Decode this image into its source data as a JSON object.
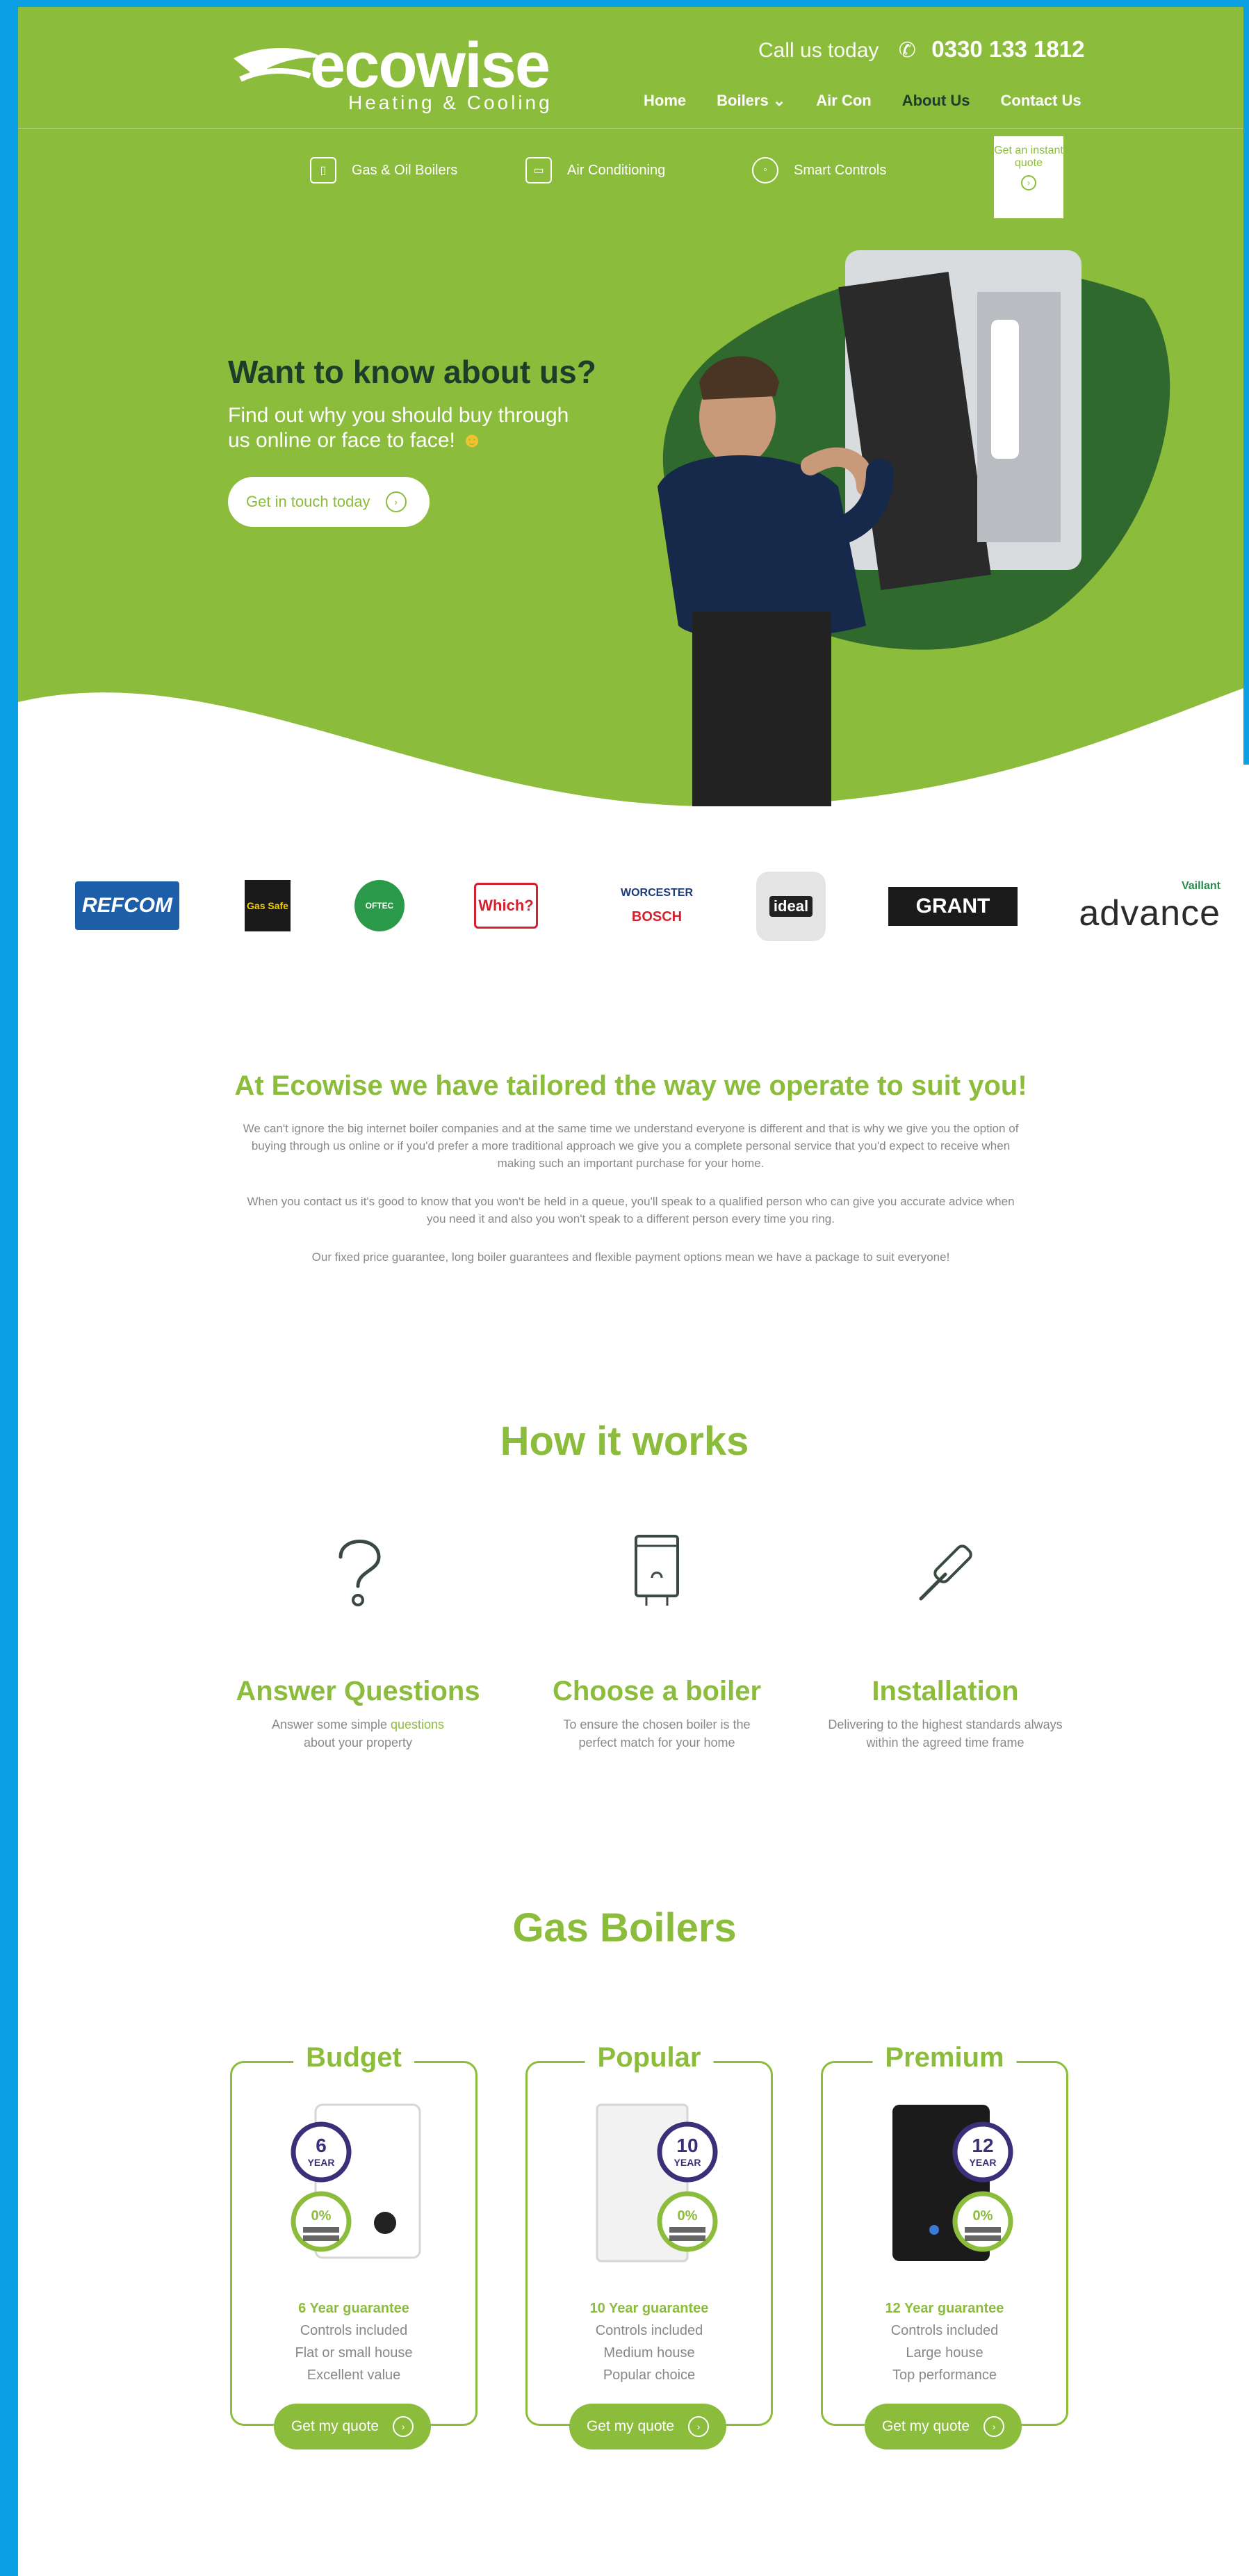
{
  "header": {
    "logo_text": "ecowise",
    "logo_tagline": "Heating & Cooling",
    "call_label": "Call us today",
    "phone_icon": "phone-icon",
    "phone": "0330 133 1812",
    "nav": [
      "Home",
      "Boilers",
      "Air Con",
      "About Us",
      "Contact Us"
    ]
  },
  "subnav": {
    "items": [
      {
        "label": "Gas & Oil Boilers",
        "icon": "boiler-icon"
      },
      {
        "label": "Air Conditioning",
        "icon": "aircon-icon"
      },
      {
        "label": "Smart Controls",
        "icon": "thermostat-icon"
      }
    ],
    "quote_box": "Get an instant quote"
  },
  "hero": {
    "title": "Want to know about us?",
    "subtitle": "Find out why you should buy through us online or face to face!",
    "button": "Get in touch today"
  },
  "brands": [
    "REFCOM",
    "Gas Safe",
    "OFTEC",
    "Which?",
    "WORCESTER",
    "BOSCH",
    "ideal",
    "GRANT",
    "Vaillant",
    "advance"
  ],
  "about": {
    "title": "At Ecowise we have tailored the way we operate to suit you!",
    "p1": "We can't ignore the big internet boiler companies and at the same time we understand everyone is different and that is why we give you the option of buying through us online or if you'd prefer a more traditional approach we give you a complete personal service that you'd expect to receive when making such an important purchase for your home.",
    "p2": "When you contact us it's good to know that you won't be held in a queue, you'll speak to a qualified person who can give you accurate advice when you need it and also you won't speak to a different person every time you ring.",
    "p3": "Our fixed price guarantee, long boiler guarantees and flexible payment options mean we have a package to suit everyone!"
  },
  "how": {
    "title": "How it works",
    "steps": [
      {
        "title": "Answer Questions",
        "text_pre": "Answer some simple ",
        "text_hl": "questions",
        "text_post": " about your property",
        "icon": "question-icon"
      },
      {
        "title": "Choose a boiler",
        "text": "To ensure the chosen boiler is the perfect match for your home",
        "icon": "boiler-icon"
      },
      {
        "title": "Installation",
        "text": "Delivering to the highest standards always within the agreed time frame",
        "icon": "screwdriver-icon"
      }
    ]
  },
  "boilers": {
    "title": "Gas Boilers",
    "cards": [
      {
        "label": "Budget",
        "guarantee": "6 Year guarantee",
        "badge_num": "6",
        "badge_word": "YEAR",
        "finance": "0%",
        "features": [
          "Controls included",
          "Flat or small house",
          "Excellent value"
        ],
        "button": "Get my quote",
        "color": "#ffffff"
      },
      {
        "label": "Popular",
        "guarantee": "10 Year guarantee",
        "badge_num": "10",
        "badge_word": "YEAR",
        "finance": "0%",
        "features": [
          "Controls included",
          "Medium house",
          "Popular choice"
        ],
        "button": "Get my quote",
        "color": "#f2f2f2"
      },
      {
        "label": "Premium",
        "guarantee": "12 Year guarantee",
        "badge_num": "12",
        "badge_word": "YEAR",
        "finance": "0%",
        "features": [
          "Controls included",
          "Large house",
          "Top performance"
        ],
        "button": "Get my quote",
        "color": "#1b1b1b"
      }
    ]
  },
  "colors": {
    "brand_green": "#8cbc3c",
    "frame_blue": "#0aa0e3",
    "dark_green": "#1d3d2a"
  }
}
